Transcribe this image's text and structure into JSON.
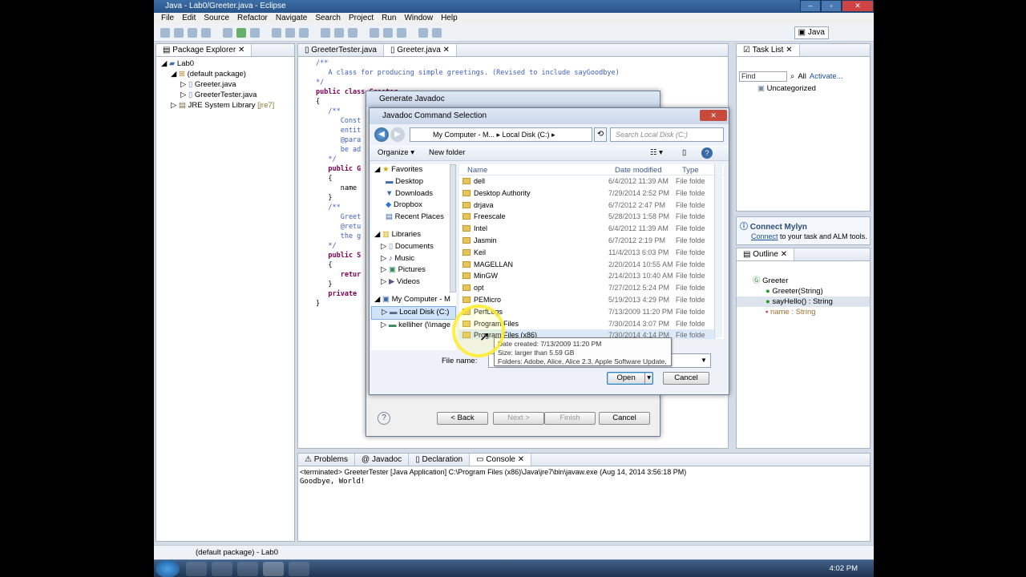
{
  "window": {
    "title": "Java - Lab0/Greeter.java - Eclipse"
  },
  "menu": [
    "File",
    "Edit",
    "Source",
    "Refactor",
    "Navigate",
    "Search",
    "Project",
    "Run",
    "Window",
    "Help"
  ],
  "perspective": "Java",
  "package_explorer": {
    "title": "Package Explorer",
    "tree": [
      "Lab0",
      "(default package)",
      "Greeter.java",
      "GreeterTester.java",
      "JRE System Library",
      "[jre7]"
    ]
  },
  "editor": {
    "tabs": [
      "GreeterTester.java",
      "Greeter.java"
    ],
    "lines": [
      {
        "t": "/**",
        "c": "cm"
      },
      {
        "t": "   A class for producing simple greetings. (Revised to include sayGoodbye)",
        "c": "cm"
      },
      {
        "t": "*/",
        "c": "cm"
      },
      {
        "t": "public class Greeter",
        "c": "kw"
      },
      {
        "t": "{",
        "c": "tx"
      },
      {
        "t": "   /**",
        "c": "cm"
      },
      {
        "t": "      Const",
        "c": "cm"
      },
      {
        "t": "      entit",
        "c": "cm"
      },
      {
        "t": "      @para",
        "c": "cm"
      },
      {
        "t": "      be ad",
        "c": "cm"
      },
      {
        "t": "   */",
        "c": "cm"
      },
      {
        "t": "   public G",
        "c": "kw"
      },
      {
        "t": "   {",
        "c": "tx"
      },
      {
        "t": "      name",
        "c": "tx"
      },
      {
        "t": "   }",
        "c": "tx"
      },
      {
        "t": "",
        "c": "tx"
      },
      {
        "t": "   /**",
        "c": "cm"
      },
      {
        "t": "      Greet",
        "c": "cm"
      },
      {
        "t": "      @retu",
        "c": "cm"
      },
      {
        "t": "      the g",
        "c": "cm"
      },
      {
        "t": "   */",
        "c": "cm"
      },
      {
        "t": "   public S",
        "c": "kw"
      },
      {
        "t": "   {",
        "c": "tx"
      },
      {
        "t": "      retur",
        "c": "kw"
      },
      {
        "t": "   }",
        "c": "tx"
      },
      {
        "t": "",
        "c": "tx"
      },
      {
        "t": "   private",
        "c": "kw"
      },
      {
        "t": "}",
        "c": "tx"
      }
    ]
  },
  "task_list": {
    "title": "Task List",
    "find_placeholder": "Find",
    "all": "All",
    "activate": "Activate...",
    "category": "Uncategorized"
  },
  "mylyn": {
    "title": "Connect Mylyn",
    "link": "Connect",
    "text": " to your task and ALM tools."
  },
  "outline": {
    "title": "Outline",
    "items": [
      "Greeter",
      "Greeter(String)",
      "sayHello() : String",
      "name : String"
    ]
  },
  "bottom": {
    "tabs": [
      "Problems",
      "Javadoc",
      "Declaration",
      "Console"
    ],
    "terminated": "<terminated> GreeterTester [Java Application] C:\\Program Files (x86)\\Java\\jre7\\bin\\javaw.exe (Aug 14, 2014 3:56:18 PM)",
    "output": "Goodbye, World!"
  },
  "status_bar": "(default package) - Lab0",
  "javadoc_wizard": {
    "title": "Generate Javadoc",
    "back": "< Back",
    "next": "Next >",
    "finish": "Finish",
    "cancel": "Cancel"
  },
  "file_dialog": {
    "title": "Javadoc Command Selection",
    "path": [
      "My Computer - M...",
      "Local Disk (C:)"
    ],
    "search_placeholder": "Search Local Disk (C:)",
    "organize": "Organize",
    "new_folder": "New folder",
    "nav": {
      "favorites": "Favorites",
      "fav_items": [
        "Desktop",
        "Downloads",
        "Dropbox",
        "Recent Places"
      ],
      "libraries": "Libraries",
      "lib_items": [
        "Documents",
        "Music",
        "Pictures",
        "Videos"
      ],
      "computer": "My Computer - M",
      "comp_items": [
        "Local Disk (C:)",
        "kelliher (\\\\mage"
      ]
    },
    "columns": {
      "name": "Name",
      "date": "Date modified",
      "type": "Type"
    },
    "files": [
      {
        "name": "dell",
        "date": "6/4/2012 11:39 AM",
        "type": "File folde"
      },
      {
        "name": "Desktop Authority",
        "date": "7/29/2014 2:52 PM",
        "type": "File folde"
      },
      {
        "name": "drjava",
        "date": "6/7/2012 2:47 PM",
        "type": "File folde"
      },
      {
        "name": "Freescale",
        "date": "5/28/2013 1:58 PM",
        "type": "File folde"
      },
      {
        "name": "Intel",
        "date": "6/4/2012 11:39 AM",
        "type": "File folde"
      },
      {
        "name": "Jasmin",
        "date": "6/7/2012 2:19 PM",
        "type": "File folde"
      },
      {
        "name": "Keil",
        "date": "11/4/2013 6:03 PM",
        "type": "File folde"
      },
      {
        "name": "MAGELLAN",
        "date": "2/20/2014 10:55 AM",
        "type": "File folde"
      },
      {
        "name": "MinGW",
        "date": "2/14/2013 10:40 AM",
        "type": "File folde"
      },
      {
        "name": "opt",
        "date": "7/27/2012 5:24 PM",
        "type": "File folde"
      },
      {
        "name": "PEMicro",
        "date": "5/19/2013 4:29 PM",
        "type": "File folde"
      },
      {
        "name": "PerfLogs",
        "date": "7/13/2009 11:20 PM",
        "type": "File folde"
      },
      {
        "name": "Program Files",
        "date": "7/30/2014 3:07 PM",
        "type": "File folde"
      },
      {
        "name": "Program Files (x86)",
        "date": "7/30/2014 4:14 PM",
        "type": "File folde"
      }
    ],
    "tooltip": [
      "Date created: 7/13/2009 11:20 PM",
      "Size: larger than 5.59 GB",
      "Folders: Adobe, Alice, Alice 2.3, Apple Software Update, ..."
    ],
    "file_name_label": "File name:",
    "open": "Open",
    "cancel": "Cancel"
  },
  "clock": "4:02 PM"
}
